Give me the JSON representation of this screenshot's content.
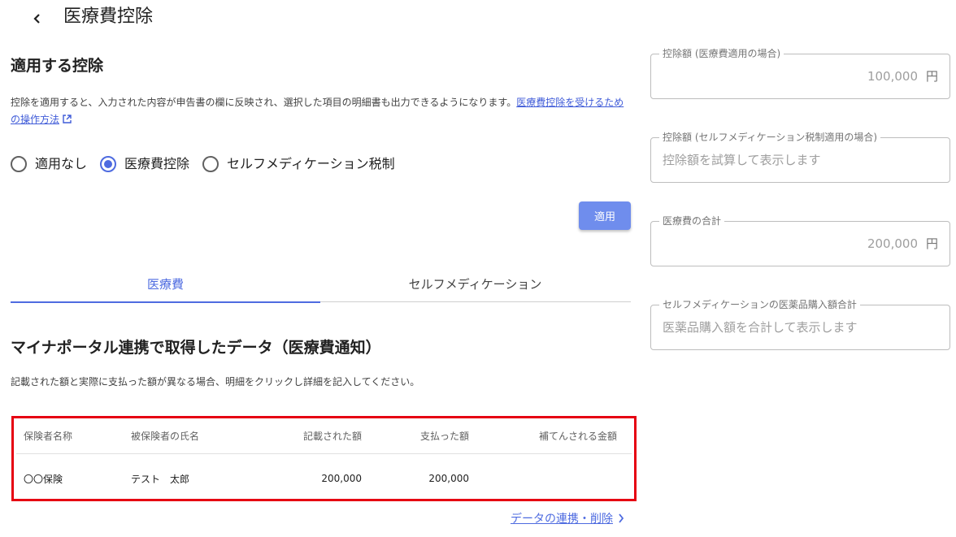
{
  "header": {
    "title": "医療費控除"
  },
  "apply_section": {
    "title": "適用する控除",
    "description": "控除を適用すると、入力された内容が申告書の欄に反映され、選択した項目の明細書も出力できるようになります。",
    "link_text": "医療費控除を受けるための操作方法",
    "options": [
      {
        "label": "適用なし",
        "checked": false
      },
      {
        "label": "医療費控除",
        "checked": true
      },
      {
        "label": "セルフメディケーション税制",
        "checked": false
      }
    ],
    "apply_button": "適用"
  },
  "tabs": [
    {
      "label": "医療費",
      "active": true
    },
    {
      "label": "セルフメディケーション",
      "active": false
    }
  ],
  "mynaportal": {
    "title": "マイナポータル連携で取得したデータ（医療費通知）",
    "description": "記載された額と実際に支払った額が異なる場合、明細をクリックし詳細を記入してください。",
    "columns": [
      "保険者名称",
      "被保険者の氏名",
      "記載された額",
      "支払った額",
      "補てんされる金額"
    ],
    "rows": [
      {
        "insurer": "〇〇保険",
        "insured_name": "テスト　太郎",
        "stated_amount": "200,000",
        "paid_amount": "200,000",
        "compensation": ""
      }
    ],
    "link": "データの連携・削除"
  },
  "summary_fields": [
    {
      "label": "控除額 (医療費適用の場合)",
      "value": "100,000",
      "unit": "円",
      "placeholder": ""
    },
    {
      "label": "控除額 (セルフメディケーション税制適用の場合)",
      "value": "",
      "unit": "",
      "placeholder": "控除額を試算して表示します"
    },
    {
      "label": "医療費の合計",
      "value": "200,000",
      "unit": "円",
      "placeholder": ""
    },
    {
      "label": "セルフメディケーションの医薬品購入額合計",
      "value": "",
      "unit": "",
      "placeholder": "医薬品購入額を合計して表示します"
    }
  ],
  "colors": {
    "accent": "#4e6be0",
    "button": "#6f8ded",
    "highlight_border": "#e60012"
  }
}
